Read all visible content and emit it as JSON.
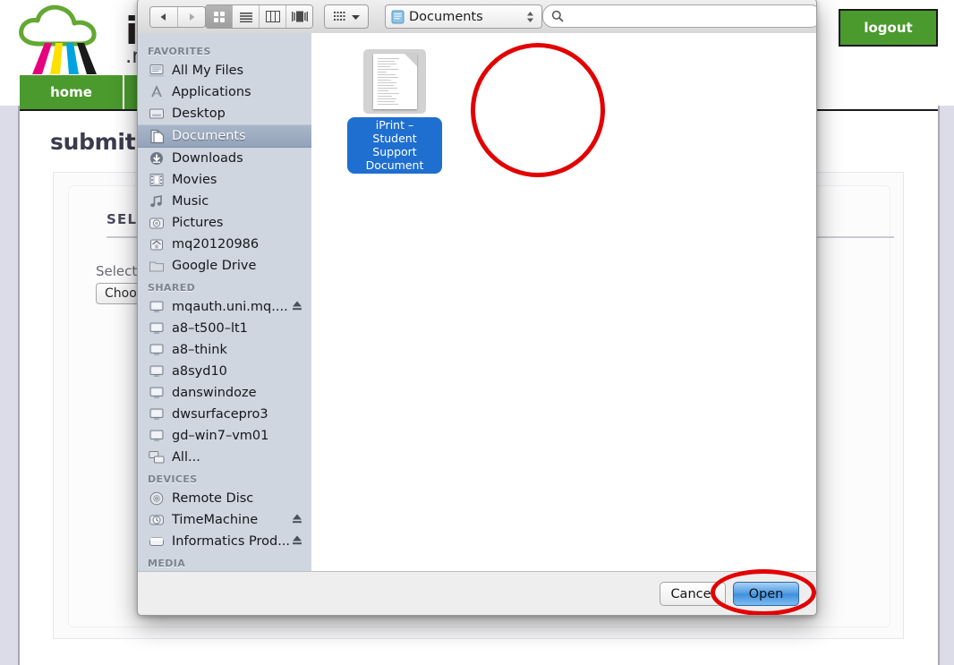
{
  "site": {
    "brand_name": "iPrint",
    "brand_sub": ".mq.edu",
    "logo_icon": "cloud-printer-logo",
    "nav": [
      {
        "label": "home",
        "name": "nav-home"
      },
      {
        "label": "",
        "name": "nav-second"
      }
    ],
    "logout_label": "logout",
    "page_title": "submit print job",
    "form": {
      "section_title": "SELECT FILE",
      "field_label": "Select a file to print",
      "choose_file_label": "Choose File"
    }
  },
  "dialog": {
    "toolbar": {
      "back_icon": "triangle-left-icon",
      "forward_icon": "triangle-right-icon",
      "view_icon_grid": "icon-view-icon",
      "view_icon_list": "list-view-icon",
      "view_icon_column": "column-view-icon",
      "view_icon_coverflow": "coverflow-view-icon",
      "arrange_icon": "arrange-by-icon",
      "arrange_caret_icon": "chevron-down-icon",
      "path_icon": "documents-folder-icon",
      "path_label": "Documents",
      "path_stepper_icon": "up-down-stepper-icon",
      "search_icon": "search-icon",
      "search_value": "",
      "search_placeholder": ""
    },
    "sidebar": {
      "groups": [
        {
          "title": "FAVORITES",
          "items": [
            {
              "label": "All My Files",
              "icon": "all-my-files-icon",
              "selected": false,
              "eject": false
            },
            {
              "label": "Applications",
              "icon": "applications-icon",
              "selected": false,
              "eject": false
            },
            {
              "label": "Desktop",
              "icon": "desktop-icon",
              "selected": false,
              "eject": false
            },
            {
              "label": "Documents",
              "icon": "documents-icon",
              "selected": true,
              "eject": false
            },
            {
              "label": "Downloads",
              "icon": "downloads-icon",
              "selected": false,
              "eject": false
            },
            {
              "label": "Movies",
              "icon": "movies-icon",
              "selected": false,
              "eject": false
            },
            {
              "label": "Music",
              "icon": "music-icon",
              "selected": false,
              "eject": false
            },
            {
              "label": "Pictures",
              "icon": "pictures-icon",
              "selected": false,
              "eject": false
            },
            {
              "label": "mq20120986",
              "icon": "home-folder-icon",
              "selected": false,
              "eject": false
            },
            {
              "label": "Google Drive",
              "icon": "folder-icon",
              "selected": false,
              "eject": false
            }
          ]
        },
        {
          "title": "SHARED",
          "items": [
            {
              "label": "mqauth.uni.mq....",
              "icon": "computer-icon",
              "selected": false,
              "eject": true
            },
            {
              "label": "a8–t500–lt1",
              "icon": "computer-icon",
              "selected": false,
              "eject": false
            },
            {
              "label": "a8–think",
              "icon": "computer-icon",
              "selected": false,
              "eject": false
            },
            {
              "label": "a8syd10",
              "icon": "computer-icon",
              "selected": false,
              "eject": false
            },
            {
              "label": "danswindoze",
              "icon": "computer-icon",
              "selected": false,
              "eject": false
            },
            {
              "label": "dwsurfacepro3",
              "icon": "computer-icon",
              "selected": false,
              "eject": false
            },
            {
              "label": "gd–win7–vm01",
              "icon": "computer-icon",
              "selected": false,
              "eject": false
            },
            {
              "label": "All...",
              "icon": "network-all-icon",
              "selected": false,
              "eject": false
            }
          ]
        },
        {
          "title": "DEVICES",
          "items": [
            {
              "label": "Remote Disc",
              "icon": "optical-disc-icon",
              "selected": false,
              "eject": false
            },
            {
              "label": "TimeMachine",
              "icon": "time-machine-disk-icon",
              "selected": false,
              "eject": true
            },
            {
              "label": "Informatics Prod...",
              "icon": "hard-disk-icon",
              "selected": false,
              "eject": true
            }
          ]
        },
        {
          "title": "MEDIA",
          "items": []
        }
      ]
    },
    "files": [
      {
        "name": "iPrint – Student Support Document",
        "icon": "document-file-icon",
        "selected": true
      }
    ],
    "buttons": {
      "cancel_label": "Cancel",
      "open_label": "Open"
    }
  },
  "annotations": {
    "color": "#e20000",
    "highlight_file": "iPrint – Student Support Document",
    "highlight_button": "Open"
  }
}
